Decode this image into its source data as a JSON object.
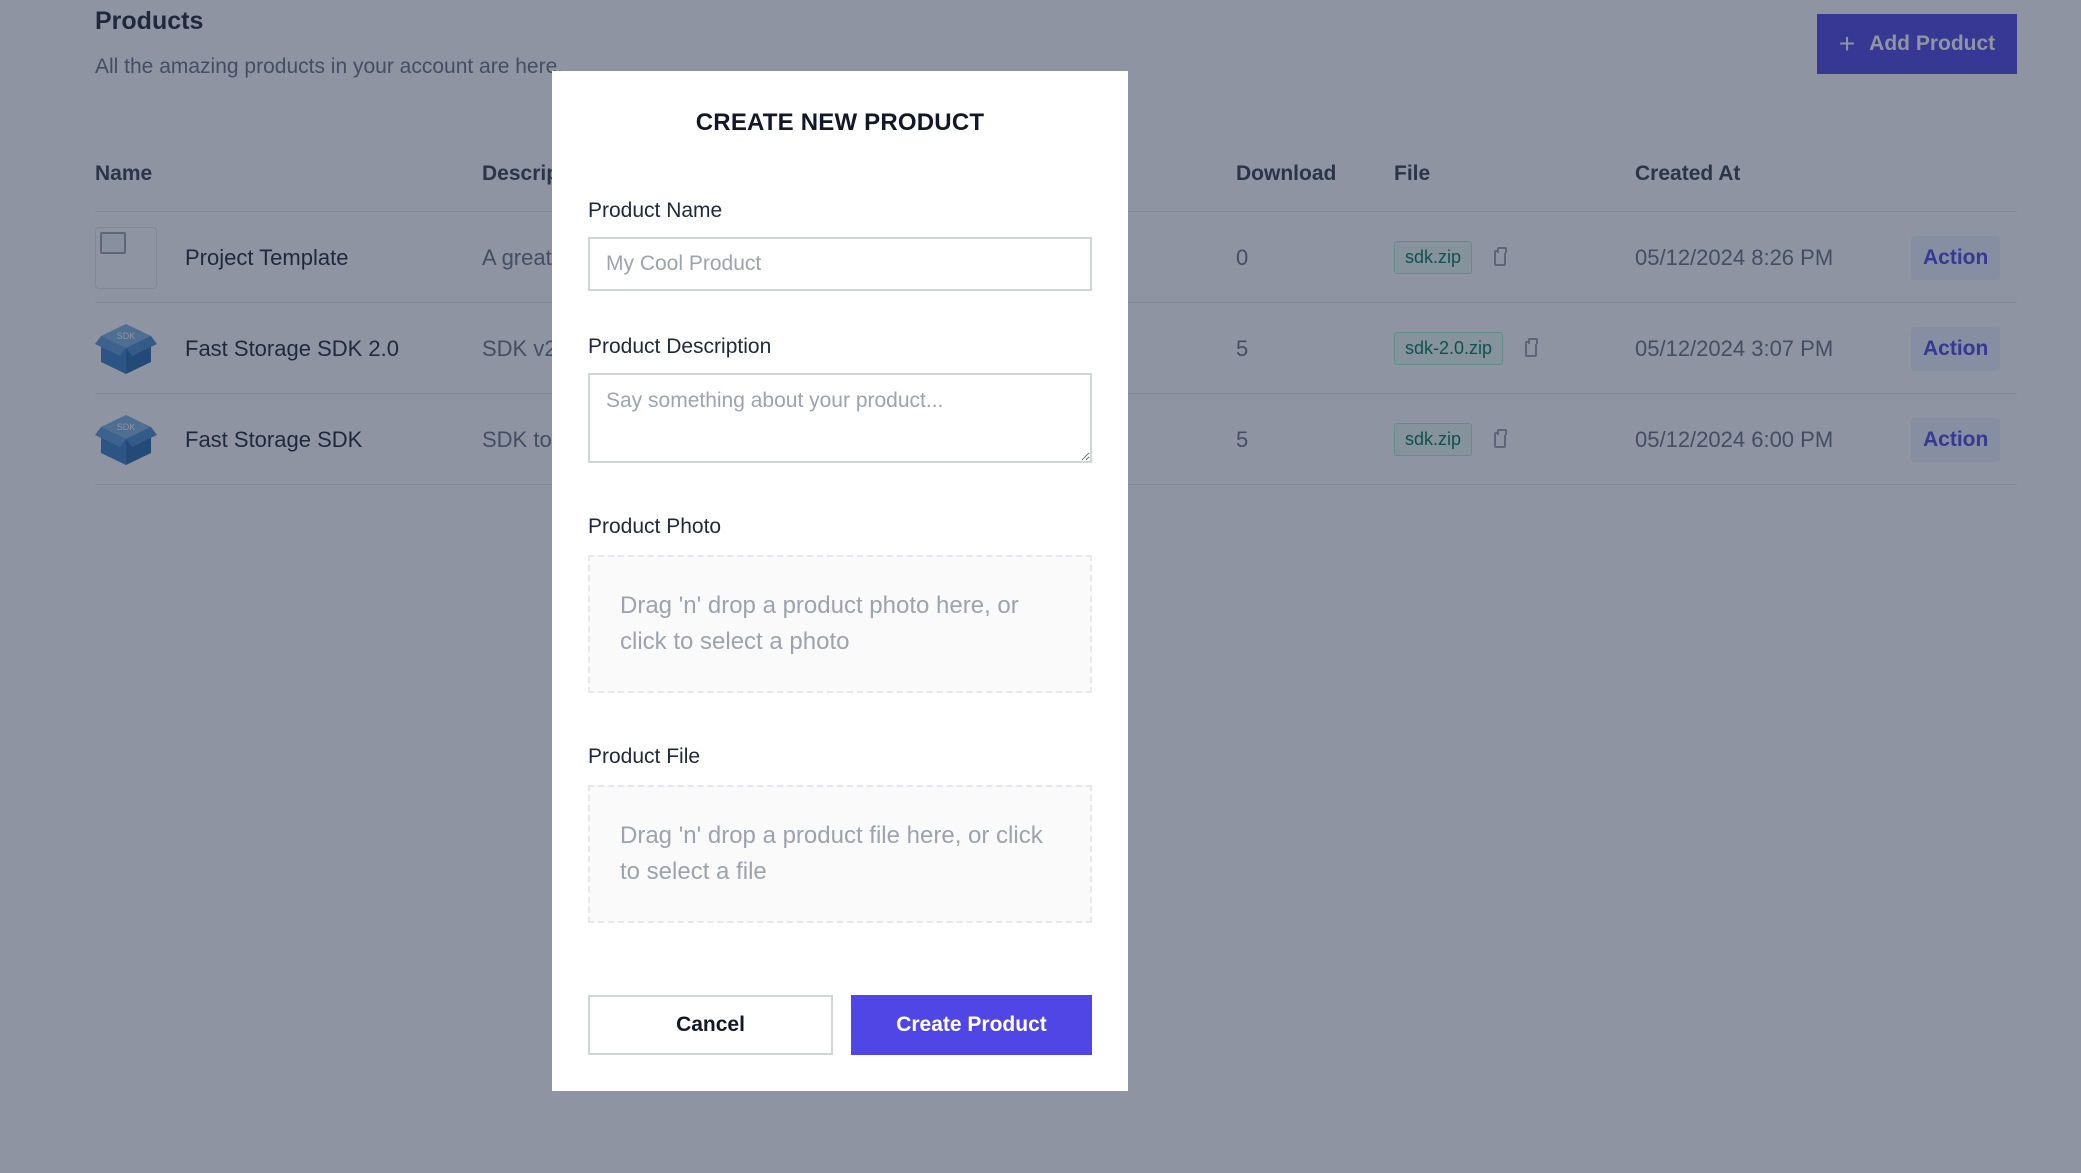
{
  "page": {
    "title": "Products",
    "subtitle": "All the amazing products in your account are here."
  },
  "toolbar": {
    "add_product_label": "Add Product"
  },
  "table": {
    "columns": [
      "Name",
      "Description",
      "Download",
      "File",
      "Created At"
    ],
    "rows": [
      {
        "name": "Project Template",
        "description": "A great",
        "downloads": "0",
        "file": "sdk.zip",
        "created_at": "05/12/2024 8:26 PM",
        "action": "Action",
        "thumb_label": ""
      },
      {
        "name": "Fast Storage SDK 2.0",
        "description": "SDK v2",
        "downloads": "5",
        "file": "sdk-2.0.zip",
        "created_at": "05/12/2024 3:07 PM",
        "action": "Action",
        "thumb_label": "SDK"
      },
      {
        "name": "Fast Storage SDK",
        "description": "SDK to",
        "downloads": "5",
        "file": "sdk.zip",
        "created_at": "05/12/2024 6:00 PM",
        "action": "Action",
        "thumb_label": "SDK"
      }
    ]
  },
  "modal": {
    "title": "CREATE NEW PRODUCT",
    "name_label": "Product Name",
    "name_placeholder": "My Cool Product",
    "name_value": "",
    "description_label": "Product Description",
    "description_placeholder": "Say something about your product...",
    "description_value": "",
    "photo_label": "Product Photo",
    "photo_dropzone_text": "Drag 'n' drop a product photo here, or click to select a photo",
    "file_label": "Product File",
    "file_dropzone_text": "Drag 'n' drop a product file here, or click to select a file",
    "cancel_label": "Cancel",
    "create_label": "Create Product"
  },
  "colors": {
    "accent": "#4f46e5",
    "overlay": "#1e2943",
    "badge_text": "#047857",
    "badge_bg": "#ecfdf5"
  },
  "icons": {
    "add": "plus-icon",
    "file_copy": "clipboard-icon",
    "product_thumb": "sdk-box-icon"
  }
}
